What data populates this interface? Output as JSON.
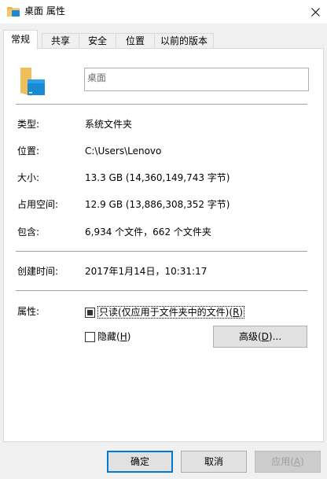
{
  "window": {
    "title": "桌面 属性",
    "icon": "folder-icon"
  },
  "tabs": [
    {
      "label": "常规"
    },
    {
      "label": "共享"
    },
    {
      "label": "安全"
    },
    {
      "label": "位置"
    },
    {
      "label": "以前的版本"
    }
  ],
  "general": {
    "name_value": "桌面",
    "type_label": "类型:",
    "type_value": "系统文件夹",
    "location_label": "位置:",
    "location_value": "C:\\Users\\Lenovo",
    "size_label": "大小:",
    "size_value": "13.3 GB (14,360,149,743 字节)",
    "disk_size_label": "占用空间:",
    "disk_size_value": "12.9 GB (13,886,308,352 字节)",
    "contains_label": "包含:",
    "contains_value": "6,934 个文件，662 个文件夹",
    "created_label": "创建时间:",
    "created_value": "2017年1月14日，10:31:17",
    "attributes_label": "属性:",
    "readonly_label": "只读(仅应用于文件夹中的文件)",
    "readonly_hotkey": "R",
    "readonly_state": "indeterminate",
    "hidden_label": "隐藏",
    "hidden_hotkey": "H",
    "hidden_state": "unchecked",
    "advanced_label": "高级",
    "advanced_hotkey": "D",
    "advanced_suffix": "..."
  },
  "footer": {
    "ok_label": "确定",
    "cancel_label": "取消",
    "apply_label": "应用",
    "apply_hotkey": "A"
  },
  "colors": {
    "accent": "#0078d7",
    "folder_yellow": "#f5c96b"
  }
}
